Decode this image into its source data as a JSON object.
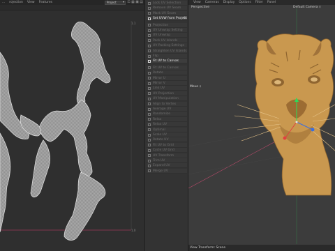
{
  "uv_editor": {
    "menu": [
      "...",
      "rojection",
      "View",
      "Features"
    ],
    "project_select": "Project",
    "tick_top_right": "1.1",
    "tick_bottom_right": "1.0"
  },
  "tool_panel": {
    "items": [
      {
        "label": "Lock UV Selection",
        "active": false
      },
      {
        "label": "Remove UV Seam",
        "active": false
      },
      {
        "label": "Mark UV Seam",
        "active": false
      },
      {
        "label": "Set UVW from Projection",
        "active": true,
        "gear": true
      },
      {
        "label": "Projection",
        "active": false
      },
      {
        "label": "UV Unwrap Setting",
        "active": false
      },
      {
        "label": "UV Unwrap",
        "active": false
      },
      {
        "label": "Pack UV Islands",
        "active": false
      },
      {
        "label": "UV Packing Settings",
        "active": false
      },
      {
        "label": "Straighten UV Islands",
        "active": false
      },
      {
        "label": "Flip",
        "active": false
      },
      {
        "label": "Fit UV to Canvas",
        "active": true
      },
      {
        "label": "Fit UV to Canvas",
        "active": false
      },
      {
        "label": "Rotate",
        "active": false
      },
      {
        "label": "Mirror U",
        "active": false
      },
      {
        "label": "Mirror V",
        "active": false
      },
      {
        "label": "Link UV",
        "active": false
      },
      {
        "label": "UV Projection",
        "active": false
      },
      {
        "label": "UV Manipulation",
        "active": false
      },
      {
        "label": "Align to Vertex",
        "active": false
      },
      {
        "label": "Average UV",
        "active": false
      },
      {
        "label": "Randomize",
        "active": false
      },
      {
        "label": "Relax",
        "active": false
      },
      {
        "label": "Relax UV",
        "active": false
      },
      {
        "label": "Optimal",
        "active": false
      },
      {
        "label": "Scale UV",
        "active": false
      },
      {
        "label": "Rotate UV",
        "active": false
      },
      {
        "label": "Fit UV to Grid",
        "active": false
      },
      {
        "label": "Cycle UV Grid",
        "active": false
      },
      {
        "label": "UV Transform",
        "active": false
      },
      {
        "label": "Trim UV",
        "active": false
      },
      {
        "label": "Expand UV",
        "active": false
      },
      {
        "label": "Merge UV",
        "active": false
      }
    ]
  },
  "viewport": {
    "menu": [
      "View",
      "Cameras",
      "Display",
      "Options",
      "Filter",
      "Panel"
    ],
    "camera_label": "Default Camera ⁝⁝",
    "projection_label": "Perspective",
    "move_label": "Move ⁝⁝",
    "status_label": "View Transform: Scene"
  },
  "colors": {
    "uv_outline": "#dcdcdc",
    "uv_fill": "#8a8a8a",
    "model_skin": "#c9984f",
    "model_shadow": "#8f6530",
    "axis_y": "#2bdc5a",
    "axis_x": "#e04040",
    "axis_z": "#3a6ee0",
    "grid_line": "#b84a6a",
    "canvas_border": "#9e3a5a"
  }
}
